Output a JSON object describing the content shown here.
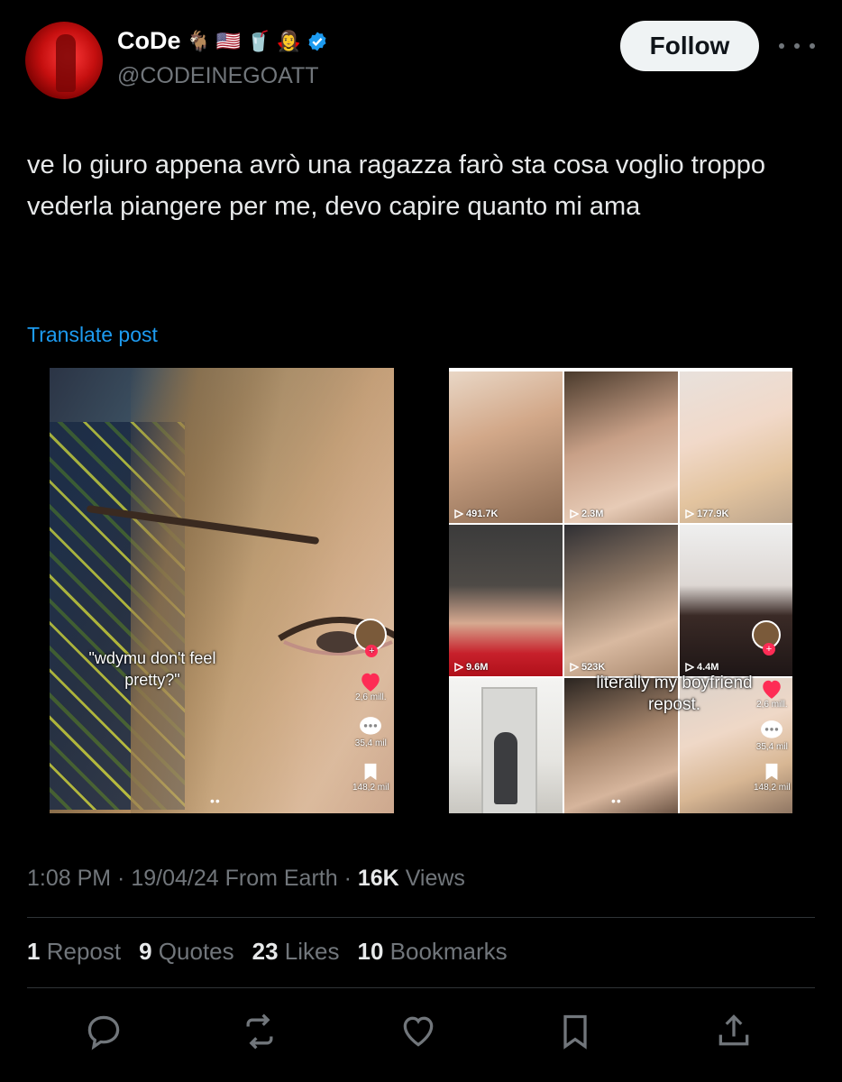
{
  "author": {
    "display_name": "CoDe",
    "emojis": [
      "🐐",
      "🇺🇸",
      "🥤",
      "🧛‍♀️"
    ],
    "handle": "@CODEINEGOATT",
    "verified": true
  },
  "header": {
    "follow_label": "Follow"
  },
  "tweet": {
    "text": "ve lo giuro appena avrò una ragazza farò sta cosa voglio troppo vederla piangere per me, devo capire quanto mi ama",
    "translate_label": "Translate post"
  },
  "media_left": {
    "caption": "\"wdymu don't feel pretty?\"",
    "likes": "2,6 mill.",
    "comments": "35,4 mil",
    "saves": "148,2 mil",
    "page_dots": "••"
  },
  "media_right": {
    "views": [
      "491.7K",
      "2.3M",
      "177.9K",
      "9.6M",
      "523K",
      "4.4M"
    ],
    "caption": "literally my boyfriend repost.",
    "likes": "2,6 mill.",
    "comments": "35,4 mil",
    "saves": "148,2 mil",
    "page_dots": "••"
  },
  "meta": {
    "time": "1:08 PM",
    "date": "19/04/24",
    "source": "From Earth",
    "views_count": "16K",
    "views_label": "Views"
  },
  "stats": {
    "reposts_count": "1",
    "reposts_label": "Repost",
    "quotes_count": "9",
    "quotes_label": "Quotes",
    "likes_count": "23",
    "likes_label": "Likes",
    "bookmarks_count": "10",
    "bookmarks_label": "Bookmarks"
  },
  "colors": {
    "background": "#000000",
    "accent_blue": "#1d9bf0",
    "secondary_text": "#71767b",
    "tiktok_red": "#fe2c55"
  },
  "icons": {
    "actions": [
      "reply-icon",
      "repost-icon",
      "like-icon",
      "bookmark-icon",
      "share-icon"
    ]
  }
}
